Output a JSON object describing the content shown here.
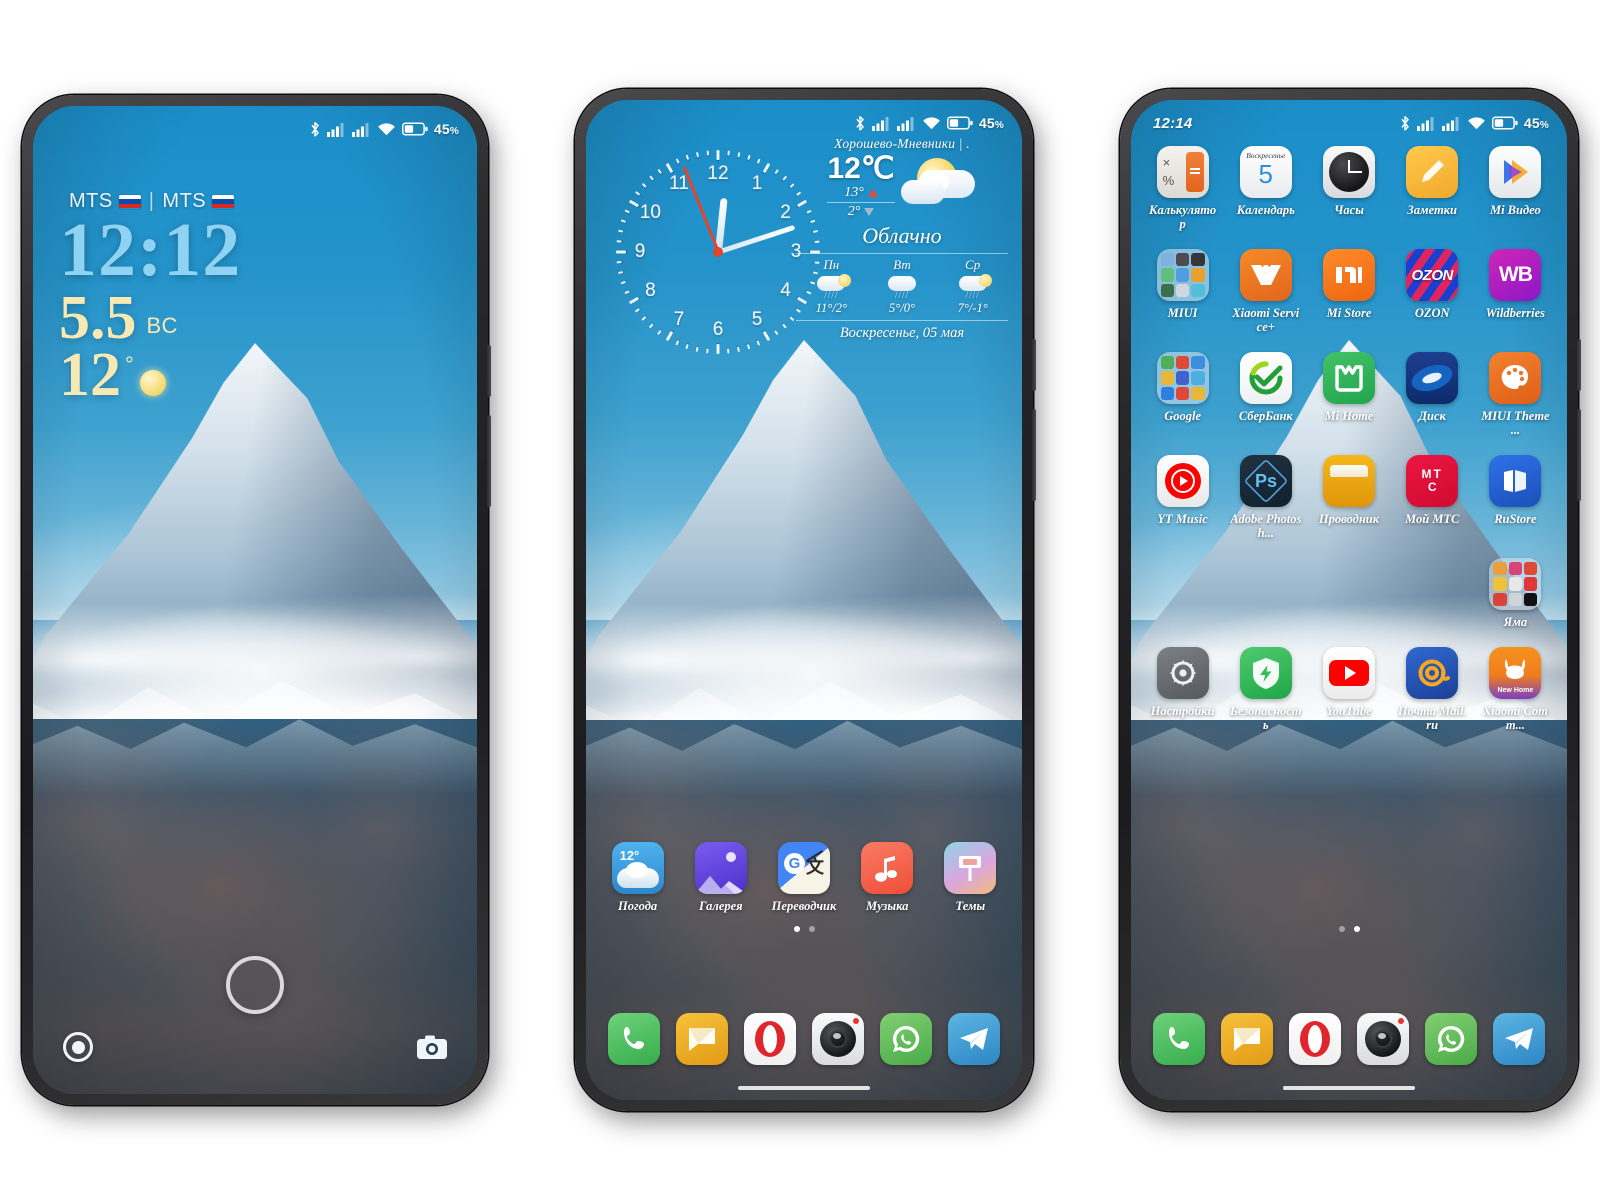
{
  "status_bar": {
    "time": "12:14",
    "battery_percent": "45",
    "battery_unit": "%",
    "icons": [
      "bluetooth-icon",
      "signal-sim1-icon",
      "signal-sim2-icon",
      "wifi-icon",
      "battery-icon"
    ]
  },
  "lockscreen": {
    "carrier_1": "MTS",
    "carrier_2": "MTS",
    "separator": "|",
    "time": "12:12",
    "day_of_week": "ВС",
    "date": "5.5",
    "temperature": "12",
    "degree": "°",
    "left_icon": "camera-lens-icon",
    "right_icon": "camera-icon",
    "unlock_hint": "unlock-ring"
  },
  "clock_widget": {
    "numbers": [
      "12",
      "1",
      "2",
      "3",
      "4",
      "5",
      "6",
      "7",
      "8",
      "9",
      "10",
      "11"
    ],
    "hour_angle": 366,
    "minute_angle": 72,
    "second_angle": 338
  },
  "weather_widget": {
    "location": "Хорошево-Мневники | .",
    "temperature": "12℃",
    "high": "13°",
    "low": "2°",
    "condition": "Облачно",
    "date": "Воскресенье, 05 мая",
    "forecast": [
      {
        "day": "Пн",
        "temps": "11°/2°",
        "icon": "cloud-sun-rain-icon"
      },
      {
        "day": "Вт",
        "temps": "5°/0°",
        "icon": "cloud-rain-icon"
      },
      {
        "day": "Ср",
        "temps": "7°/-1°",
        "icon": "cloud-sun-rain-icon"
      }
    ]
  },
  "home_page_2": {
    "apps": [
      {
        "name": "Погода",
        "icon": "weather-icon",
        "badge": "12°"
      },
      {
        "name": "Галерея",
        "icon": "gallery-icon"
      },
      {
        "name": "Переводчик",
        "icon": "translate-icon"
      },
      {
        "name": "Музыка",
        "icon": "music-icon"
      },
      {
        "name": "Темы",
        "icon": "themes-icon"
      }
    ],
    "page_dots": {
      "count": 2,
      "active": 0
    }
  },
  "home_page_3": {
    "rows": [
      [
        {
          "name": "Калькулятор",
          "icon": "calculator-icon"
        },
        {
          "name": "Календарь",
          "icon": "calendar-icon",
          "badge_top": "Воскресенье",
          "badge_num": "5"
        },
        {
          "name": "Часы",
          "icon": "clock-icon"
        },
        {
          "name": "Заметки",
          "icon": "notes-icon"
        },
        {
          "name": "Mi Видео",
          "icon": "mi-video-icon"
        }
      ],
      [
        {
          "name": "MIUI",
          "icon": "folder-icon"
        },
        {
          "name": "Xiaomi Service+",
          "icon": "xiaomi-service-icon"
        },
        {
          "name": "Mi Store",
          "icon": "mi-store-icon"
        },
        {
          "name": "OZON",
          "icon": "ozon-icon"
        },
        {
          "name": "Wildberries",
          "icon": "wildberries-icon"
        }
      ],
      [
        {
          "name": "Google",
          "icon": "folder-icon"
        },
        {
          "name": "СберБанк",
          "icon": "sberbank-icon"
        },
        {
          "name": "Mi Home",
          "icon": "mi-home-icon"
        },
        {
          "name": "Диск",
          "icon": "disk-icon"
        },
        {
          "name": "MIUI Theme ...",
          "icon": "miui-theme-icon"
        }
      ],
      [
        {
          "name": "YT Music",
          "icon": "yt-music-icon"
        },
        {
          "name": "Adobe Photosh...",
          "icon": "photoshop-icon"
        },
        {
          "name": "Проводник",
          "icon": "file-explorer-icon"
        },
        {
          "name": "Мой МТС",
          "icon": "mts-icon"
        },
        {
          "name": "RuStore",
          "icon": "rustore-icon"
        }
      ],
      [
        {
          "name": "",
          "icon": "empty"
        },
        {
          "name": "",
          "icon": "empty"
        },
        {
          "name": "",
          "icon": "empty"
        },
        {
          "name": "",
          "icon": "empty"
        },
        {
          "name": "Яма",
          "icon": "folder-icon"
        }
      ],
      [
        {
          "name": "Настройки",
          "icon": "settings-icon"
        },
        {
          "name": "Безопасность",
          "icon": "security-icon"
        },
        {
          "name": "YouTube",
          "icon": "youtube-icon"
        },
        {
          "name": "Почта Mail.ru",
          "icon": "mailru-icon"
        },
        {
          "name": "Xiaomi Comm...",
          "icon": "xiaomi-community-icon",
          "badge": "New Home"
        }
      ]
    ],
    "page_dots": {
      "count": 2,
      "active": 1
    }
  },
  "dock": {
    "apps": [
      {
        "name": "phone-icon"
      },
      {
        "name": "messages-icon"
      },
      {
        "name": "opera-icon"
      },
      {
        "name": "camera-icon"
      },
      {
        "name": "whatsapp-icon"
      },
      {
        "name": "telegram-icon"
      }
    ]
  },
  "colors": {
    "accent_blue": "#1d7fb8",
    "lock_time": "#8fd2f2",
    "lock_date": "#f6e9b4",
    "sber_green": "#21a038",
    "mts_red": "#e30611",
    "youtube_red": "#ff0000",
    "whatsapp_green": "#5ab862",
    "telegram_blue": "#3d9fd6",
    "opera_red": "#d91f2d",
    "ozon_blue": "#005bff",
    "wildberries_magenta": "#cb11ab",
    "mi_orange": "#ff6900"
  }
}
